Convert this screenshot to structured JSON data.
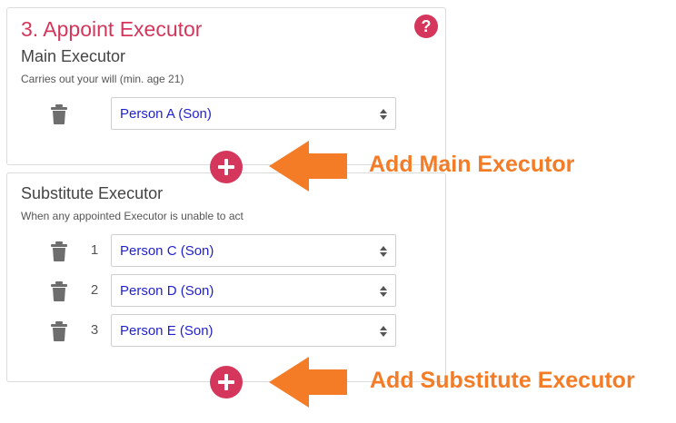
{
  "section": {
    "title": "3. Appoint Executor",
    "help_label": "?"
  },
  "main_executor": {
    "heading": "Main Executor",
    "hint": "Carries out your will (min. age 21)",
    "rows": [
      {
        "value": "Person A (Son)"
      }
    ]
  },
  "substitute_executor": {
    "heading": "Substitute Executor",
    "hint": "When any appointed Executor is unable to act",
    "rows": [
      {
        "number": "1",
        "value": "Person C (Son)"
      },
      {
        "number": "2",
        "value": "Person D (Son)"
      },
      {
        "number": "3",
        "value": "Person E (Son)"
      }
    ]
  },
  "annotations": {
    "add_main": "Add Main Executor",
    "add_substitute": "Add Substitute Executor"
  },
  "icons": {
    "trash": "trash-icon",
    "add": "plus-icon",
    "help": "question-icon",
    "caret": "sort-caret-icon"
  },
  "colors": {
    "accent": "#d4365c",
    "callout": "#f47c26",
    "select_text": "#1f1fcc",
    "trash": "#6e6e6e"
  }
}
